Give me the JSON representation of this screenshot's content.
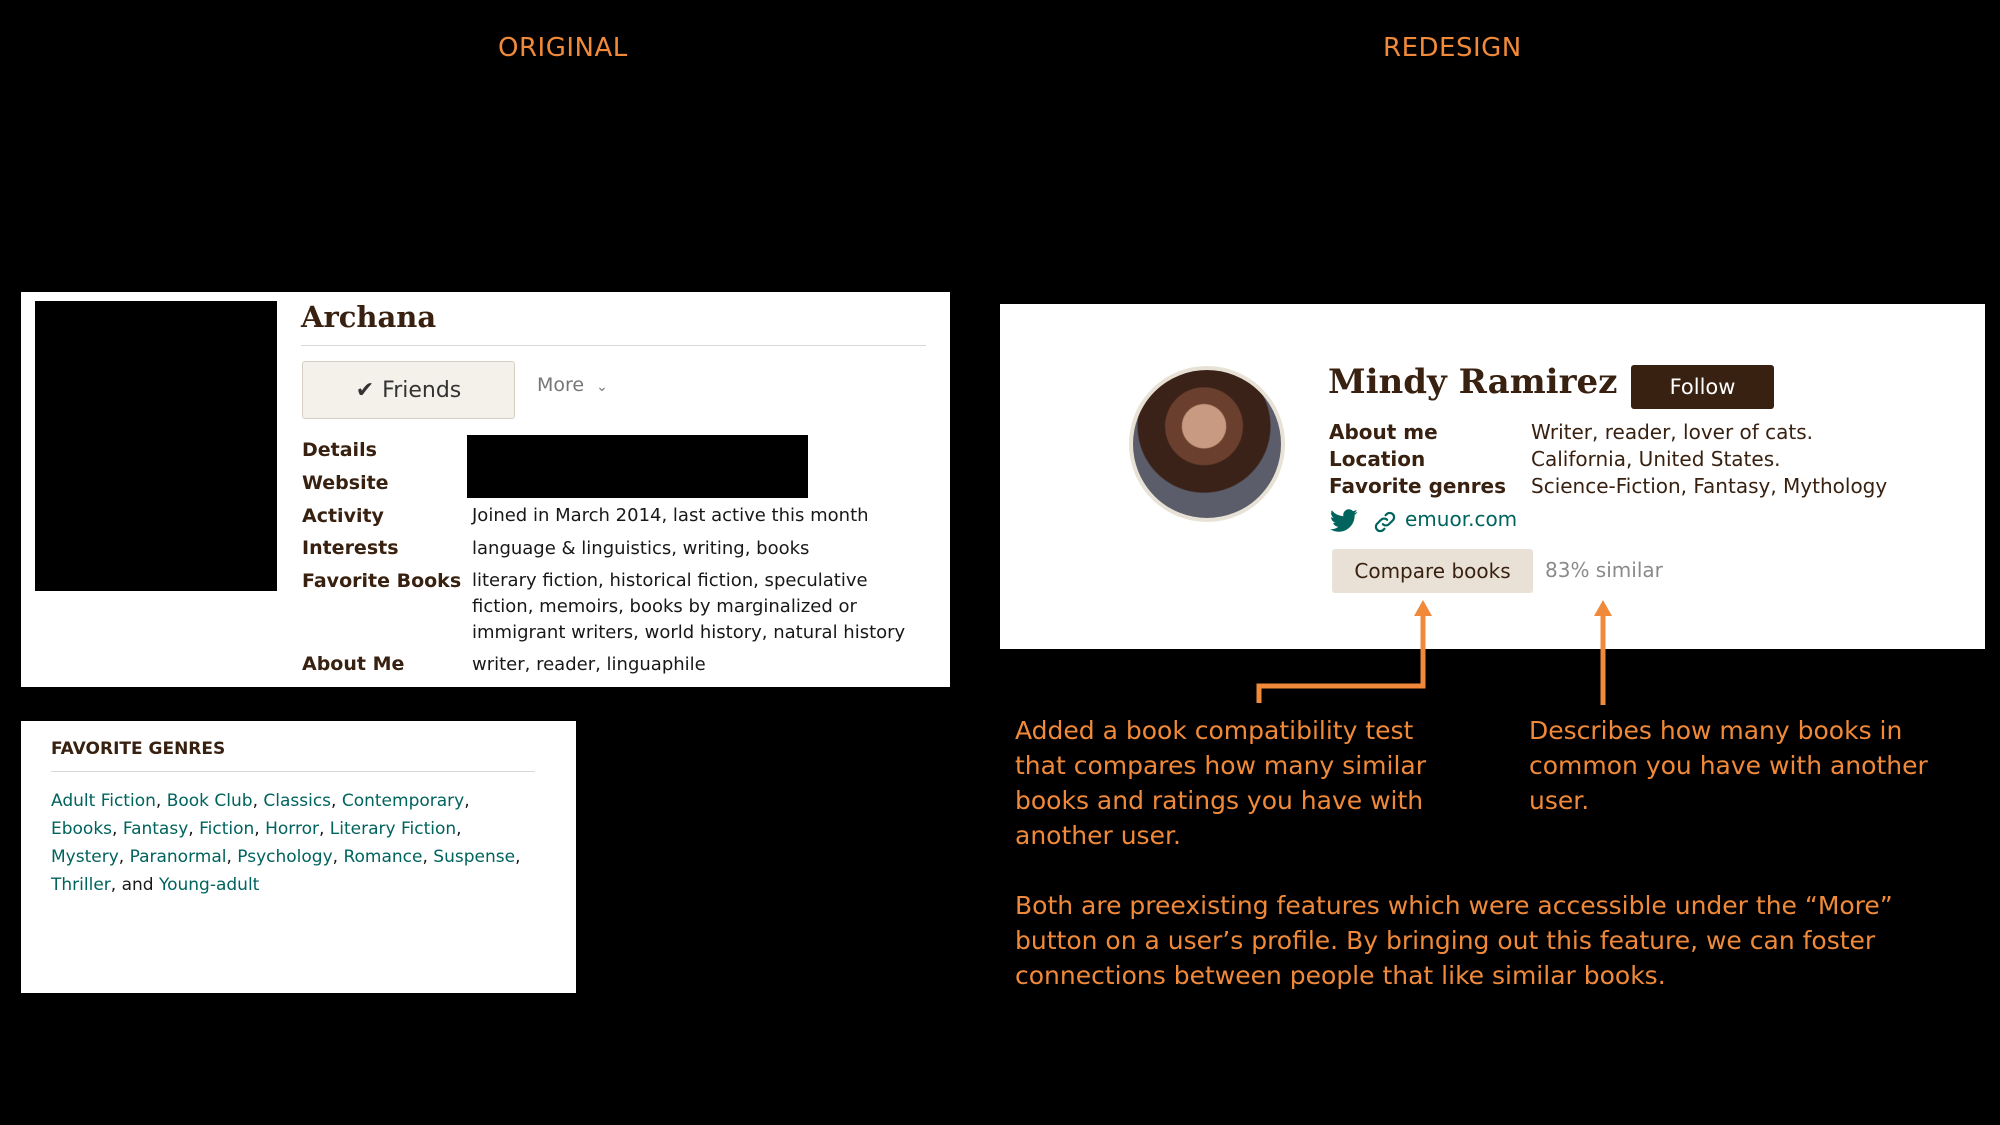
{
  "headings": {
    "original": "ORIGINAL",
    "redesign": "REDESIGN"
  },
  "original": {
    "name": "Archana",
    "friends_label": "Friends",
    "friends_icon": "check-icon",
    "more_label": "More",
    "rows": [
      {
        "label": "Details",
        "value": ""
      },
      {
        "label": "Website",
        "value": ""
      },
      {
        "label": "Activity",
        "value": "Joined in March 2014, last active this month"
      },
      {
        "label": "Interests",
        "value": "language & linguistics, writing, books"
      },
      {
        "label": "Favorite Books",
        "value": "literary fiction, historical fiction, speculative fiction, memoirs, books by marginalized or immigrant writers, world history, natural history"
      },
      {
        "label": "About Me",
        "value": "writer, reader, linguaphile"
      }
    ]
  },
  "genres": {
    "title": "FAVORITE GENRES",
    "items": [
      "Adult Fiction",
      "Book Club",
      "Classics",
      "Contemporary",
      "Ebooks",
      "Fantasy",
      "Fiction",
      "Horror",
      "Literary Fiction",
      "Mystery",
      "Paranormal",
      "Psychology",
      "Romance",
      "Suspense",
      "Thriller",
      "Young-adult"
    ],
    "conjunction": "and"
  },
  "redesign": {
    "name": "Mindy Ramirez",
    "follow_label": "Follow",
    "rows": [
      {
        "label": "About me",
        "value": "Writer, reader, lover of cats."
      },
      {
        "label": "Location",
        "value": "California, United States."
      },
      {
        "label": "Favorite genres",
        "value": "Science-Fiction, Fantasy, Mythology"
      }
    ],
    "website": "emuor.com",
    "compare_label": "Compare books",
    "similarity": "83% similar"
  },
  "annotations": {
    "compat": "Added a book compatibility test that compares how many similar books and ratings you have with another user.",
    "common": "Describes how many books in common you have with another user.",
    "both": "Both are preexisting features which were accessible under the “More” button on a user’s profile. By bringing out this feature, we can foster connections between people that like similar books."
  },
  "colors": {
    "accent": "#f08a3a",
    "brand_brown": "#382110",
    "link_green": "#00635d",
    "button_beige": "#e9e1d6"
  }
}
